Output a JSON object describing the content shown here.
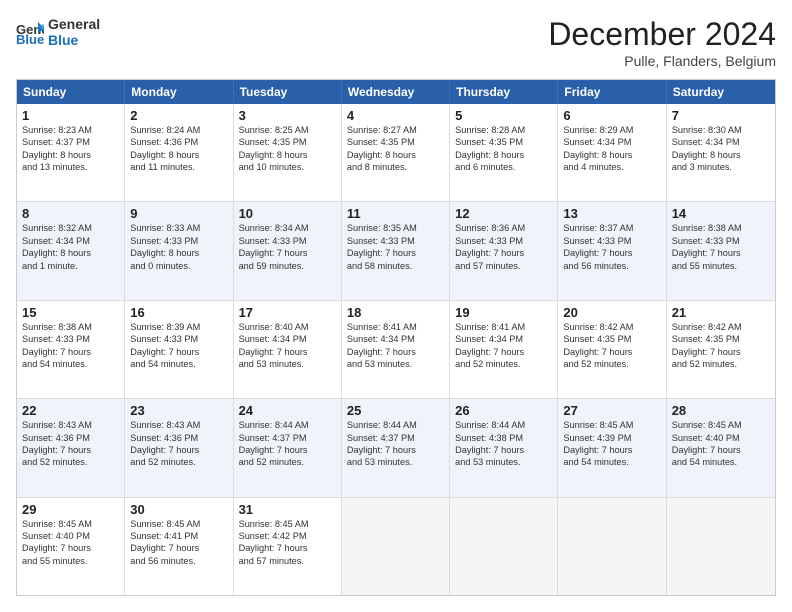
{
  "header": {
    "logo_line1": "General",
    "logo_line2": "Blue",
    "month": "December 2024",
    "location": "Pulle, Flanders, Belgium"
  },
  "weekdays": [
    "Sunday",
    "Monday",
    "Tuesday",
    "Wednesday",
    "Thursday",
    "Friday",
    "Saturday"
  ],
  "rows": [
    [
      {
        "day": "1",
        "info": "Sunrise: 8:23 AM\nSunset: 4:37 PM\nDaylight: 8 hours\nand 13 minutes."
      },
      {
        "day": "2",
        "info": "Sunrise: 8:24 AM\nSunset: 4:36 PM\nDaylight: 8 hours\nand 11 minutes."
      },
      {
        "day": "3",
        "info": "Sunrise: 8:25 AM\nSunset: 4:35 PM\nDaylight: 8 hours\nand 10 minutes."
      },
      {
        "day": "4",
        "info": "Sunrise: 8:27 AM\nSunset: 4:35 PM\nDaylight: 8 hours\nand 8 minutes."
      },
      {
        "day": "5",
        "info": "Sunrise: 8:28 AM\nSunset: 4:35 PM\nDaylight: 8 hours\nand 6 minutes."
      },
      {
        "day": "6",
        "info": "Sunrise: 8:29 AM\nSunset: 4:34 PM\nDaylight: 8 hours\nand 4 minutes."
      },
      {
        "day": "7",
        "info": "Sunrise: 8:30 AM\nSunset: 4:34 PM\nDaylight: 8 hours\nand 3 minutes."
      }
    ],
    [
      {
        "day": "8",
        "info": "Sunrise: 8:32 AM\nSunset: 4:34 PM\nDaylight: 8 hours\nand 1 minute."
      },
      {
        "day": "9",
        "info": "Sunrise: 8:33 AM\nSunset: 4:33 PM\nDaylight: 8 hours\nand 0 minutes."
      },
      {
        "day": "10",
        "info": "Sunrise: 8:34 AM\nSunset: 4:33 PM\nDaylight: 7 hours\nand 59 minutes."
      },
      {
        "day": "11",
        "info": "Sunrise: 8:35 AM\nSunset: 4:33 PM\nDaylight: 7 hours\nand 58 minutes."
      },
      {
        "day": "12",
        "info": "Sunrise: 8:36 AM\nSunset: 4:33 PM\nDaylight: 7 hours\nand 57 minutes."
      },
      {
        "day": "13",
        "info": "Sunrise: 8:37 AM\nSunset: 4:33 PM\nDaylight: 7 hours\nand 56 minutes."
      },
      {
        "day": "14",
        "info": "Sunrise: 8:38 AM\nSunset: 4:33 PM\nDaylight: 7 hours\nand 55 minutes."
      }
    ],
    [
      {
        "day": "15",
        "info": "Sunrise: 8:38 AM\nSunset: 4:33 PM\nDaylight: 7 hours\nand 54 minutes."
      },
      {
        "day": "16",
        "info": "Sunrise: 8:39 AM\nSunset: 4:33 PM\nDaylight: 7 hours\nand 54 minutes."
      },
      {
        "day": "17",
        "info": "Sunrise: 8:40 AM\nSunset: 4:34 PM\nDaylight: 7 hours\nand 53 minutes."
      },
      {
        "day": "18",
        "info": "Sunrise: 8:41 AM\nSunset: 4:34 PM\nDaylight: 7 hours\nand 53 minutes."
      },
      {
        "day": "19",
        "info": "Sunrise: 8:41 AM\nSunset: 4:34 PM\nDaylight: 7 hours\nand 52 minutes."
      },
      {
        "day": "20",
        "info": "Sunrise: 8:42 AM\nSunset: 4:35 PM\nDaylight: 7 hours\nand 52 minutes."
      },
      {
        "day": "21",
        "info": "Sunrise: 8:42 AM\nSunset: 4:35 PM\nDaylight: 7 hours\nand 52 minutes."
      }
    ],
    [
      {
        "day": "22",
        "info": "Sunrise: 8:43 AM\nSunset: 4:36 PM\nDaylight: 7 hours\nand 52 minutes."
      },
      {
        "day": "23",
        "info": "Sunrise: 8:43 AM\nSunset: 4:36 PM\nDaylight: 7 hours\nand 52 minutes."
      },
      {
        "day": "24",
        "info": "Sunrise: 8:44 AM\nSunset: 4:37 PM\nDaylight: 7 hours\nand 52 minutes."
      },
      {
        "day": "25",
        "info": "Sunrise: 8:44 AM\nSunset: 4:37 PM\nDaylight: 7 hours\nand 53 minutes."
      },
      {
        "day": "26",
        "info": "Sunrise: 8:44 AM\nSunset: 4:38 PM\nDaylight: 7 hours\nand 53 minutes."
      },
      {
        "day": "27",
        "info": "Sunrise: 8:45 AM\nSunset: 4:39 PM\nDaylight: 7 hours\nand 54 minutes."
      },
      {
        "day": "28",
        "info": "Sunrise: 8:45 AM\nSunset: 4:40 PM\nDaylight: 7 hours\nand 54 minutes."
      }
    ],
    [
      {
        "day": "29",
        "info": "Sunrise: 8:45 AM\nSunset: 4:40 PM\nDaylight: 7 hours\nand 55 minutes."
      },
      {
        "day": "30",
        "info": "Sunrise: 8:45 AM\nSunset: 4:41 PM\nDaylight: 7 hours\nand 56 minutes."
      },
      {
        "day": "31",
        "info": "Sunrise: 8:45 AM\nSunset: 4:42 PM\nDaylight: 7 hours\nand 57 minutes."
      },
      {
        "day": "",
        "info": ""
      },
      {
        "day": "",
        "info": ""
      },
      {
        "day": "",
        "info": ""
      },
      {
        "day": "",
        "info": ""
      }
    ]
  ]
}
